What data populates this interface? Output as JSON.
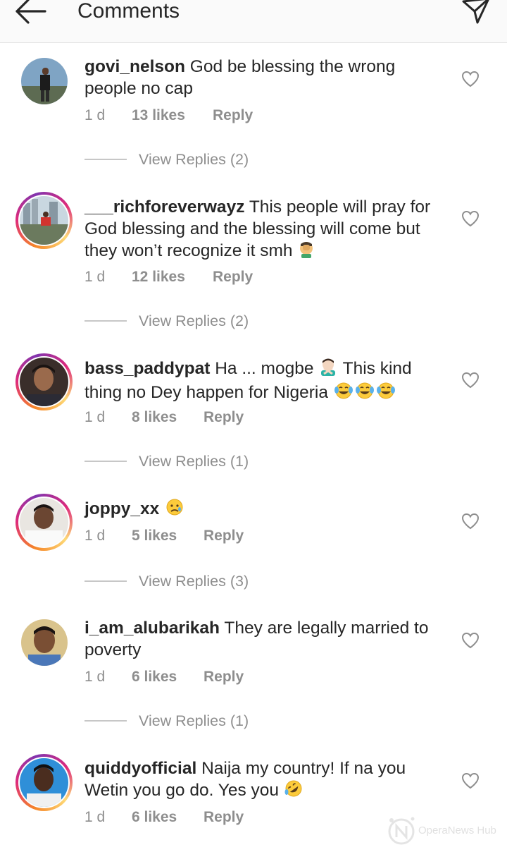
{
  "header": {
    "title": "Comments"
  },
  "comments": [
    {
      "username": "govi_nelson",
      "text": "God be blessing the wrong people no cap",
      "time": "1 d",
      "likes": "13 likes",
      "reply_label": "Reply",
      "view_replies": "View Replies (2)",
      "story_ring": false
    },
    {
      "username": "___richforeverwayz",
      "text": "This people will pray for God blessing and the blessing will come but they won’t recognize it smh",
      "emoji": "face-palm",
      "time": "1 d",
      "likes": "12 likes",
      "reply_label": "Reply",
      "view_replies": "View Replies (2)",
      "story_ring": true
    },
    {
      "username": "bass_paddypat",
      "text_before_emoji": "Ha ... mogbe",
      "text_after_emoji": "This kind thing no Dey happen for Nigeria",
      "emoji": "person-gesturing-no",
      "trailing_emojis": [
        "tears-of-joy",
        "tears-of-joy",
        "tears-of-joy"
      ],
      "time": "1 d",
      "likes": "8 likes",
      "reply_label": "Reply",
      "view_replies": "View Replies (1)",
      "story_ring": true
    },
    {
      "username": "joppy_xx",
      "text": "",
      "emoji": "sad-but-relieved-face",
      "time": "1 d",
      "likes": "5 likes",
      "reply_label": "Reply",
      "view_replies": "View Replies (3)",
      "story_ring": true
    },
    {
      "username": "i_am_alubarikah",
      "text": "They are legally married to poverty",
      "time": "1 d",
      "likes": "6 likes",
      "reply_label": "Reply",
      "view_replies": "View Replies (1)",
      "story_ring": false
    },
    {
      "username": "quiddyofficial",
      "text": "Naija my country! If na you Wetin you go do. Yes you",
      "emoji": "rolling-on-floor-laughing",
      "time": "1 d",
      "likes": "6 likes",
      "reply_label": "Reply",
      "story_ring": true
    }
  ],
  "watermark": {
    "text": "OperaNews Hub"
  },
  "colors": {
    "text": "#262626",
    "secondary": "#8e8e8e",
    "divider": "#c7c7c7",
    "header_bg": "#fafafa"
  }
}
